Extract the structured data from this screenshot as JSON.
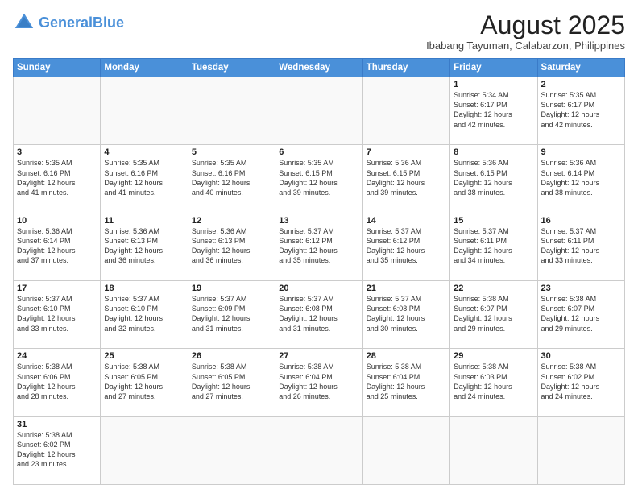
{
  "header": {
    "logo_general": "General",
    "logo_blue": "Blue",
    "month_year": "August 2025",
    "location": "Ibabang Tayuman, Calabarzon, Philippines"
  },
  "weekdays": [
    "Sunday",
    "Monday",
    "Tuesday",
    "Wednesday",
    "Thursday",
    "Friday",
    "Saturday"
  ],
  "weeks": [
    [
      {
        "day": "",
        "info": ""
      },
      {
        "day": "",
        "info": ""
      },
      {
        "day": "",
        "info": ""
      },
      {
        "day": "",
        "info": ""
      },
      {
        "day": "",
        "info": ""
      },
      {
        "day": "1",
        "info": "Sunrise: 5:34 AM\nSunset: 6:17 PM\nDaylight: 12 hours\nand 42 minutes."
      },
      {
        "day": "2",
        "info": "Sunrise: 5:35 AM\nSunset: 6:17 PM\nDaylight: 12 hours\nand 42 minutes."
      }
    ],
    [
      {
        "day": "3",
        "info": "Sunrise: 5:35 AM\nSunset: 6:16 PM\nDaylight: 12 hours\nand 41 minutes."
      },
      {
        "day": "4",
        "info": "Sunrise: 5:35 AM\nSunset: 6:16 PM\nDaylight: 12 hours\nand 41 minutes."
      },
      {
        "day": "5",
        "info": "Sunrise: 5:35 AM\nSunset: 6:16 PM\nDaylight: 12 hours\nand 40 minutes."
      },
      {
        "day": "6",
        "info": "Sunrise: 5:35 AM\nSunset: 6:15 PM\nDaylight: 12 hours\nand 39 minutes."
      },
      {
        "day": "7",
        "info": "Sunrise: 5:36 AM\nSunset: 6:15 PM\nDaylight: 12 hours\nand 39 minutes."
      },
      {
        "day": "8",
        "info": "Sunrise: 5:36 AM\nSunset: 6:15 PM\nDaylight: 12 hours\nand 38 minutes."
      },
      {
        "day": "9",
        "info": "Sunrise: 5:36 AM\nSunset: 6:14 PM\nDaylight: 12 hours\nand 38 minutes."
      }
    ],
    [
      {
        "day": "10",
        "info": "Sunrise: 5:36 AM\nSunset: 6:14 PM\nDaylight: 12 hours\nand 37 minutes."
      },
      {
        "day": "11",
        "info": "Sunrise: 5:36 AM\nSunset: 6:13 PM\nDaylight: 12 hours\nand 36 minutes."
      },
      {
        "day": "12",
        "info": "Sunrise: 5:36 AM\nSunset: 6:13 PM\nDaylight: 12 hours\nand 36 minutes."
      },
      {
        "day": "13",
        "info": "Sunrise: 5:37 AM\nSunset: 6:12 PM\nDaylight: 12 hours\nand 35 minutes."
      },
      {
        "day": "14",
        "info": "Sunrise: 5:37 AM\nSunset: 6:12 PM\nDaylight: 12 hours\nand 35 minutes."
      },
      {
        "day": "15",
        "info": "Sunrise: 5:37 AM\nSunset: 6:11 PM\nDaylight: 12 hours\nand 34 minutes."
      },
      {
        "day": "16",
        "info": "Sunrise: 5:37 AM\nSunset: 6:11 PM\nDaylight: 12 hours\nand 33 minutes."
      }
    ],
    [
      {
        "day": "17",
        "info": "Sunrise: 5:37 AM\nSunset: 6:10 PM\nDaylight: 12 hours\nand 33 minutes."
      },
      {
        "day": "18",
        "info": "Sunrise: 5:37 AM\nSunset: 6:10 PM\nDaylight: 12 hours\nand 32 minutes."
      },
      {
        "day": "19",
        "info": "Sunrise: 5:37 AM\nSunset: 6:09 PM\nDaylight: 12 hours\nand 31 minutes."
      },
      {
        "day": "20",
        "info": "Sunrise: 5:37 AM\nSunset: 6:08 PM\nDaylight: 12 hours\nand 31 minutes."
      },
      {
        "day": "21",
        "info": "Sunrise: 5:37 AM\nSunset: 6:08 PM\nDaylight: 12 hours\nand 30 minutes."
      },
      {
        "day": "22",
        "info": "Sunrise: 5:38 AM\nSunset: 6:07 PM\nDaylight: 12 hours\nand 29 minutes."
      },
      {
        "day": "23",
        "info": "Sunrise: 5:38 AM\nSunset: 6:07 PM\nDaylight: 12 hours\nand 29 minutes."
      }
    ],
    [
      {
        "day": "24",
        "info": "Sunrise: 5:38 AM\nSunset: 6:06 PM\nDaylight: 12 hours\nand 28 minutes."
      },
      {
        "day": "25",
        "info": "Sunrise: 5:38 AM\nSunset: 6:05 PM\nDaylight: 12 hours\nand 27 minutes."
      },
      {
        "day": "26",
        "info": "Sunrise: 5:38 AM\nSunset: 6:05 PM\nDaylight: 12 hours\nand 27 minutes."
      },
      {
        "day": "27",
        "info": "Sunrise: 5:38 AM\nSunset: 6:04 PM\nDaylight: 12 hours\nand 26 minutes."
      },
      {
        "day": "28",
        "info": "Sunrise: 5:38 AM\nSunset: 6:04 PM\nDaylight: 12 hours\nand 25 minutes."
      },
      {
        "day": "29",
        "info": "Sunrise: 5:38 AM\nSunset: 6:03 PM\nDaylight: 12 hours\nand 24 minutes."
      },
      {
        "day": "30",
        "info": "Sunrise: 5:38 AM\nSunset: 6:02 PM\nDaylight: 12 hours\nand 24 minutes."
      }
    ],
    [
      {
        "day": "31",
        "info": "Sunrise: 5:38 AM\nSunset: 6:02 PM\nDaylight: 12 hours\nand 23 minutes."
      },
      {
        "day": "",
        "info": ""
      },
      {
        "day": "",
        "info": ""
      },
      {
        "day": "",
        "info": ""
      },
      {
        "day": "",
        "info": ""
      },
      {
        "day": "",
        "info": ""
      },
      {
        "day": "",
        "info": ""
      }
    ]
  ]
}
